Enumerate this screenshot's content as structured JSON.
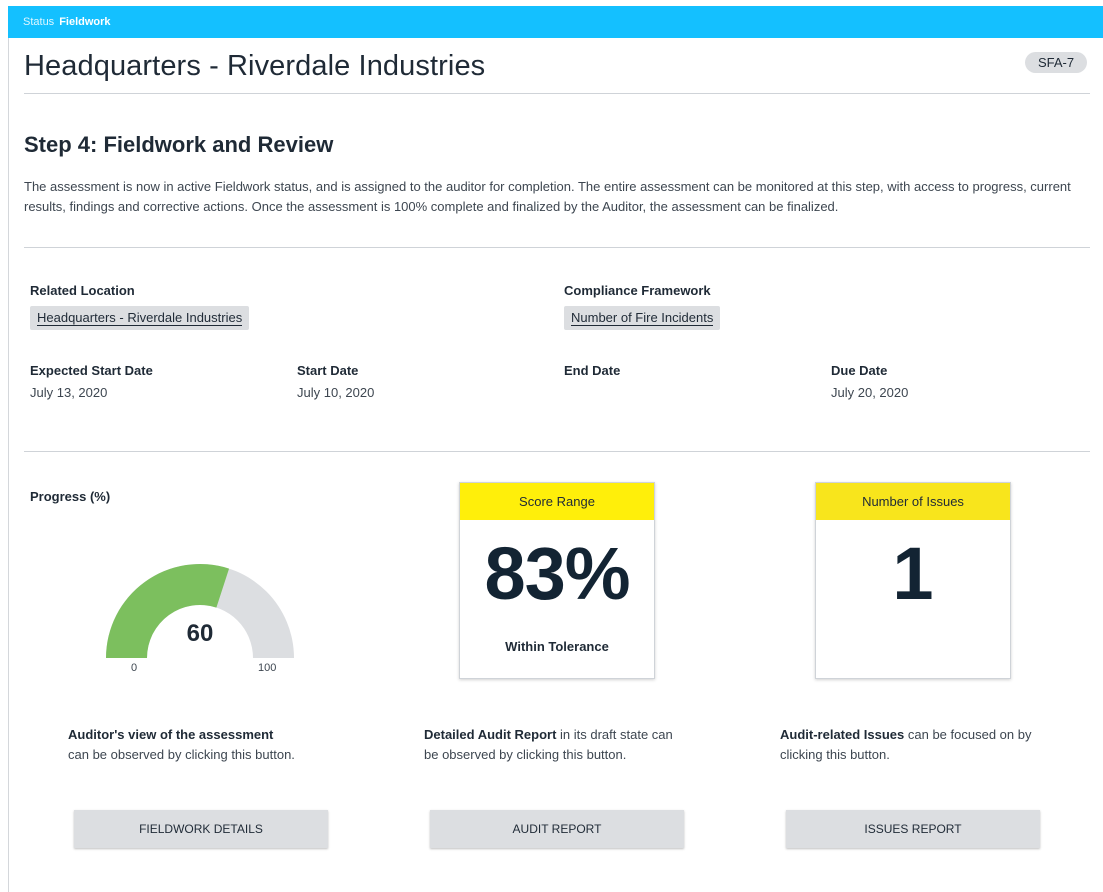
{
  "status": {
    "label": "Status",
    "value": "Fieldwork"
  },
  "header": {
    "title": "Headquarters - Riverdale Industries",
    "badge": "SFA-7"
  },
  "step": {
    "heading": "Step 4: Fieldwork and Review",
    "description": "The assessment is now in active Fieldwork status, and is assigned to the auditor for completion. The entire assessment can be monitored at this step, with access to progress, current results, findings and corrective actions. Once the assessment is 100% complete and finalized by the Auditor, the assessment can be finalized."
  },
  "fields": {
    "related_location": {
      "label": "Related Location",
      "value": "Headquarters - Riverdale Industries"
    },
    "compliance_framework": {
      "label": "Compliance Framework",
      "value": "Number of Fire Incidents"
    },
    "expected_start_date": {
      "label": "Expected Start Date",
      "value": "July 13, 2020"
    },
    "start_date": {
      "label": "Start Date",
      "value": "July 10, 2020"
    },
    "end_date": {
      "label": "End Date",
      "value": ""
    },
    "due_date": {
      "label": "Due Date",
      "value": "July 20, 2020"
    }
  },
  "progress": {
    "label": "Progress (%)",
    "value": 60,
    "min": 0,
    "max": 100,
    "display": "60",
    "min_label": "0",
    "max_label": "100",
    "fill_color": "#7cbf5e",
    "track_color": "#dcdee1"
  },
  "score_card": {
    "title": "Score Range",
    "value": "83%",
    "subtitle": "Within Tolerance"
  },
  "issues_card": {
    "title": "Number of Issues",
    "value": "1"
  },
  "descriptions": {
    "fieldwork": {
      "bold": "Auditor's view of the assessment",
      "rest": "can be observed by clicking this button."
    },
    "audit": {
      "bold": "Detailed Audit Report",
      "rest": " in its draft state can be observed by clicking this button."
    },
    "issues": {
      "bold": "Audit-related Issues",
      "rest": " can be focused on by clicking this button."
    }
  },
  "buttons": {
    "fieldwork_details": "FIELDWORK DETAILS",
    "audit_report": "AUDIT REPORT",
    "issues_report": "ISSUES REPORT"
  }
}
